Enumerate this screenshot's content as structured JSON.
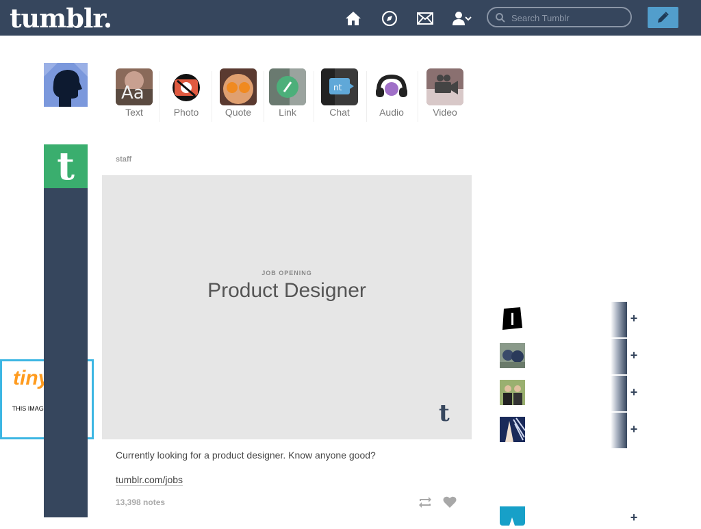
{
  "header": {
    "logo": "tumblr.",
    "search_placeholder": "Search Tumblr",
    "icons": [
      "home-icon",
      "explore-icon",
      "inbox-icon",
      "account-icon",
      "compose-icon"
    ]
  },
  "post_types": [
    {
      "label": "Text",
      "icon": "text-icon"
    },
    {
      "label": "Photo",
      "icon": "photo-icon"
    },
    {
      "label": "Quote",
      "icon": "quote-icon"
    },
    {
      "label": "Link",
      "icon": "link-icon"
    },
    {
      "label": "Chat",
      "icon": "chat-icon"
    },
    {
      "label": "Audio",
      "icon": "audio-icon"
    },
    {
      "label": "Video",
      "icon": "video-icon"
    }
  ],
  "blog_avatar_letter": "t",
  "post": {
    "author": "staff",
    "image_eyebrow": "JOB OPENING",
    "image_headline": "Product Designer",
    "image_mark": "t",
    "body": "Currently looking for a product designer. Know anyone good?",
    "link": "tumblr.com/jobs",
    "notes": "13,398 notes"
  },
  "ad": {
    "logo": "tiny",
    "text": "THIS IMAGE HAS MOVED OR"
  },
  "recommended": {
    "follow_label": "+"
  },
  "colors": {
    "header_bg": "#36465d",
    "accent_blue": "#529ecc",
    "blog_green": "#3aae6e"
  }
}
